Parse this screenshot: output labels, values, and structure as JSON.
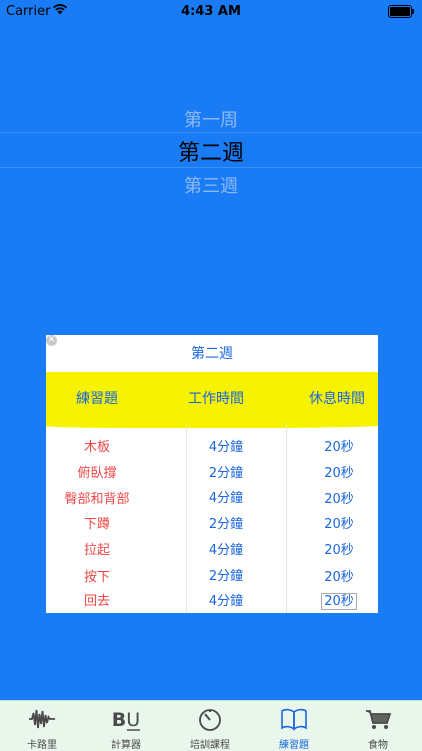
{
  "status": {
    "carrier": "Carrier",
    "time": "4:43 AM"
  },
  "picker": {
    "items": [
      "第一周",
      "第二週",
      "第三週"
    ],
    "selected": "第二週"
  },
  "card": {
    "title": "第二週",
    "headers": [
      "練習題",
      "工作時間",
      "休息時間"
    ],
    "rows": [
      {
        "exercise": "木板",
        "work": "4分鐘",
        "rest": "20秒"
      },
      {
        "exercise": "俯臥撐",
        "work": "2分鐘",
        "rest": "20秒"
      },
      {
        "exercise": "臀部和背部",
        "work": "4分鐘",
        "rest": "20秒"
      },
      {
        "exercise": "下蹲",
        "work": "2分鐘",
        "rest": "20秒"
      },
      {
        "exercise": "拉起",
        "work": "4分鐘",
        "rest": "20秒"
      },
      {
        "exercise": "按下",
        "work": "2分鐘",
        "rest": "20秒"
      },
      {
        "exercise": "回去",
        "work": "4分鐘",
        "rest": "20秒"
      }
    ]
  },
  "tabbar": {
    "items": [
      {
        "label": "卡路里",
        "icon": "waveform-icon"
      },
      {
        "label": "計算器",
        "icon": "bu-text-icon"
      },
      {
        "label": "培訓課程",
        "icon": "timer-icon"
      },
      {
        "label": "練習題",
        "icon": "book-icon"
      },
      {
        "label": "食物",
        "icon": "cart-icon"
      }
    ],
    "active": 3
  },
  "colors": {
    "background": "#1a7cf5",
    "highlight": "#f6f200",
    "accent": "#1a66e0",
    "exercise_text": "#f04646",
    "tabbar_bg": "#e8f6ec"
  }
}
